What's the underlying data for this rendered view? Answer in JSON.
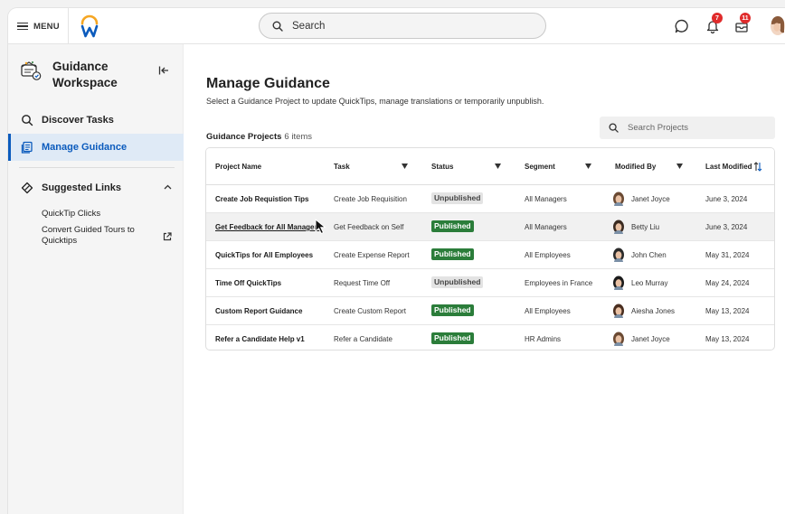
{
  "topbar": {
    "menu_label": "MENU",
    "search_placeholder": "Search",
    "notifications_count": "7",
    "inbox_count": "11"
  },
  "sidebar": {
    "workspace_title": "Guidance Workspace",
    "nav": [
      {
        "label": "Discover Tasks",
        "icon": "search-icon",
        "active": false
      },
      {
        "label": "Manage Guidance",
        "icon": "document-list-icon",
        "active": true
      }
    ],
    "suggested": {
      "label": "Suggested Links",
      "links": [
        "QuickTip Clicks",
        "Convert Guided Tours to Quicktips"
      ]
    }
  },
  "main": {
    "title": "Manage Guidance",
    "subtitle": "Select a Guidance Project to update QuickTips, manage translations or temporarily unpublish.",
    "projects_label": "Guidance Projects",
    "projects_count": "6 items",
    "search_placeholder": "Search Projects",
    "columns": [
      "Project Name",
      "Task",
      "Status",
      "Segment",
      "Modified By",
      "Last Modified"
    ],
    "rows": [
      {
        "project": "Create Job Requistion Tips",
        "task": "Create Job Requisition",
        "status": "Unpublished",
        "segment": "All Managers",
        "modified_by": "Janet Joyce",
        "last_modified": "June 3, 2024"
      },
      {
        "project": "Get Feedback for All Managers",
        "task": "Get Feedback on Self",
        "status": "Published",
        "segment": "All Managers",
        "modified_by": "Betty Liu",
        "last_modified": "June 3, 2024"
      },
      {
        "project": "QuickTips for All Employees",
        "task": "Create Expense Report",
        "status": "Published",
        "segment": "All Employees",
        "modified_by": "John Chen",
        "last_modified": "May 31, 2024"
      },
      {
        "project": "Time Off QuickTips",
        "task": "Request Time Off",
        "status": "Unpublished",
        "segment": "Employees in France",
        "modified_by": "Leo Murray",
        "last_modified": "May 24, 2024"
      },
      {
        "project": "Custom Report Guidance",
        "task": "Create Custom Report",
        "status": "Published",
        "segment": "All Employees",
        "modified_by": "Aiesha Jones",
        "last_modified": "May 13, 2024"
      },
      {
        "project": "Refer a Candidate Help v1",
        "task": "Refer a Candidate",
        "status": "Published",
        "segment": "HR Admins",
        "modified_by": "Janet Joyce",
        "last_modified": "May 13, 2024"
      }
    ]
  },
  "colors": {
    "accent": "#0b5bbd",
    "published": "#2b7d3a",
    "unpublished_bg": "#e3e3e3",
    "badge": "#e02b2b",
    "logo_orange": "#f5a623",
    "logo_blue": "#0b5bbd"
  }
}
